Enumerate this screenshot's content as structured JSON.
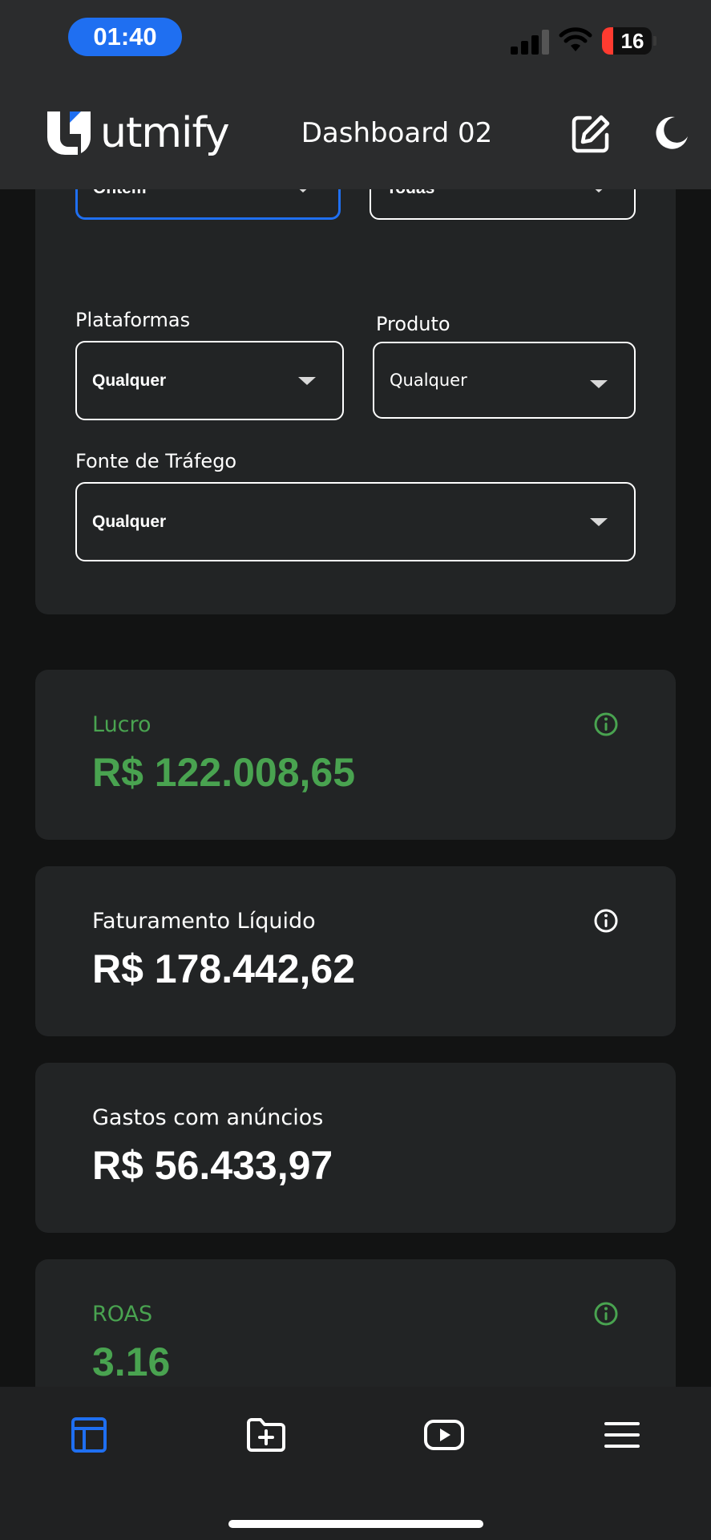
{
  "status_bar": {
    "time": "01:40",
    "battery_level": "16",
    "battery_color": "#ff3b30"
  },
  "header": {
    "brand": "utmify",
    "title": "Dashboard 02",
    "edit_icon": "edit-icon",
    "theme_icon": "moon-icon"
  },
  "filters": {
    "period": {
      "value": "Ontem",
      "active": true
    },
    "account": {
      "value": "Todas"
    },
    "platforms": {
      "label": "Plataformas",
      "value": "Qualquer"
    },
    "product": {
      "label": "Produto",
      "value": "Qualquer"
    },
    "traffic_source": {
      "label": "Fonte de Tráfego",
      "value": "Qualquer"
    }
  },
  "metrics": [
    {
      "label": "Lucro",
      "value": "R$ 122.008,65",
      "color": "#49a350",
      "has_info": true
    },
    {
      "label": "Faturamento Líquido",
      "value": "R$ 178.442,62",
      "color": "#ffffff",
      "has_info": true
    },
    {
      "label": "Gastos com anúncios",
      "value": "R$ 56.433,97",
      "color": "#ffffff",
      "has_info": false
    },
    {
      "label": "ROAS",
      "value": "3.16",
      "color": "#49a350",
      "has_info": true
    }
  ],
  "bottom_nav": {
    "items": [
      {
        "icon": "dashboard-icon",
        "active": true
      },
      {
        "icon": "folder-add-icon",
        "active": false
      },
      {
        "icon": "video-play-icon",
        "active": false
      },
      {
        "icon": "menu-icon",
        "active": false
      }
    ],
    "accent": "#1f6ff1"
  }
}
